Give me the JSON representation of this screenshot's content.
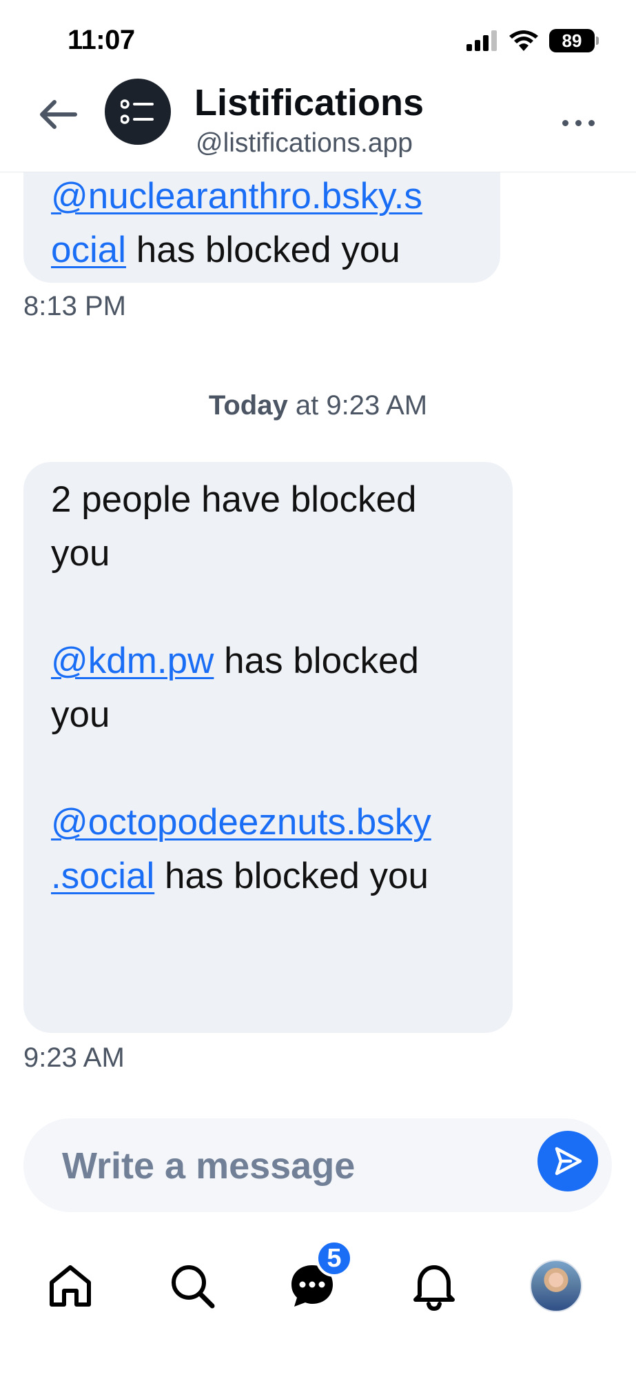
{
  "status_bar": {
    "time": "11:07",
    "battery": "89"
  },
  "header": {
    "title": "Listifications",
    "handle": "@listifications.app"
  },
  "messages": {
    "earlier": {
      "mention_line1": "@nuclearanthro.bsky.s",
      "mention_line2": "ocial",
      "suffix": "has blocked you",
      "time": "8:13 PM"
    },
    "day_separator": {
      "day": "Today",
      "rest": "at 9:23 AM"
    },
    "latest": {
      "line1": "2 people have blocked",
      "line2": "you",
      "mention_a": "@kdm.pw",
      "mention_a_suffix": "has blocked",
      "mention_a_line2": "you",
      "mention_b_line1": "@octopodeeznuts.bsky",
      "mention_b_line2": ".social",
      "mention_b_suffix": "has blocked you",
      "time": "9:23 AM"
    }
  },
  "composer": {
    "placeholder": "Write a message"
  },
  "nav": {
    "items": [
      {
        "name": "home",
        "icon": "home-icon"
      },
      {
        "name": "search",
        "icon": "search-icon"
      },
      {
        "name": "chat",
        "icon": "chat-icon",
        "badge": "5"
      },
      {
        "name": "notifications",
        "icon": "bell-icon"
      },
      {
        "name": "profile",
        "icon": "avatar"
      }
    ]
  },
  "colors": {
    "accent": "#1a6ef5",
    "bubble": "#eef1f6",
    "muted": "#4b5563"
  }
}
